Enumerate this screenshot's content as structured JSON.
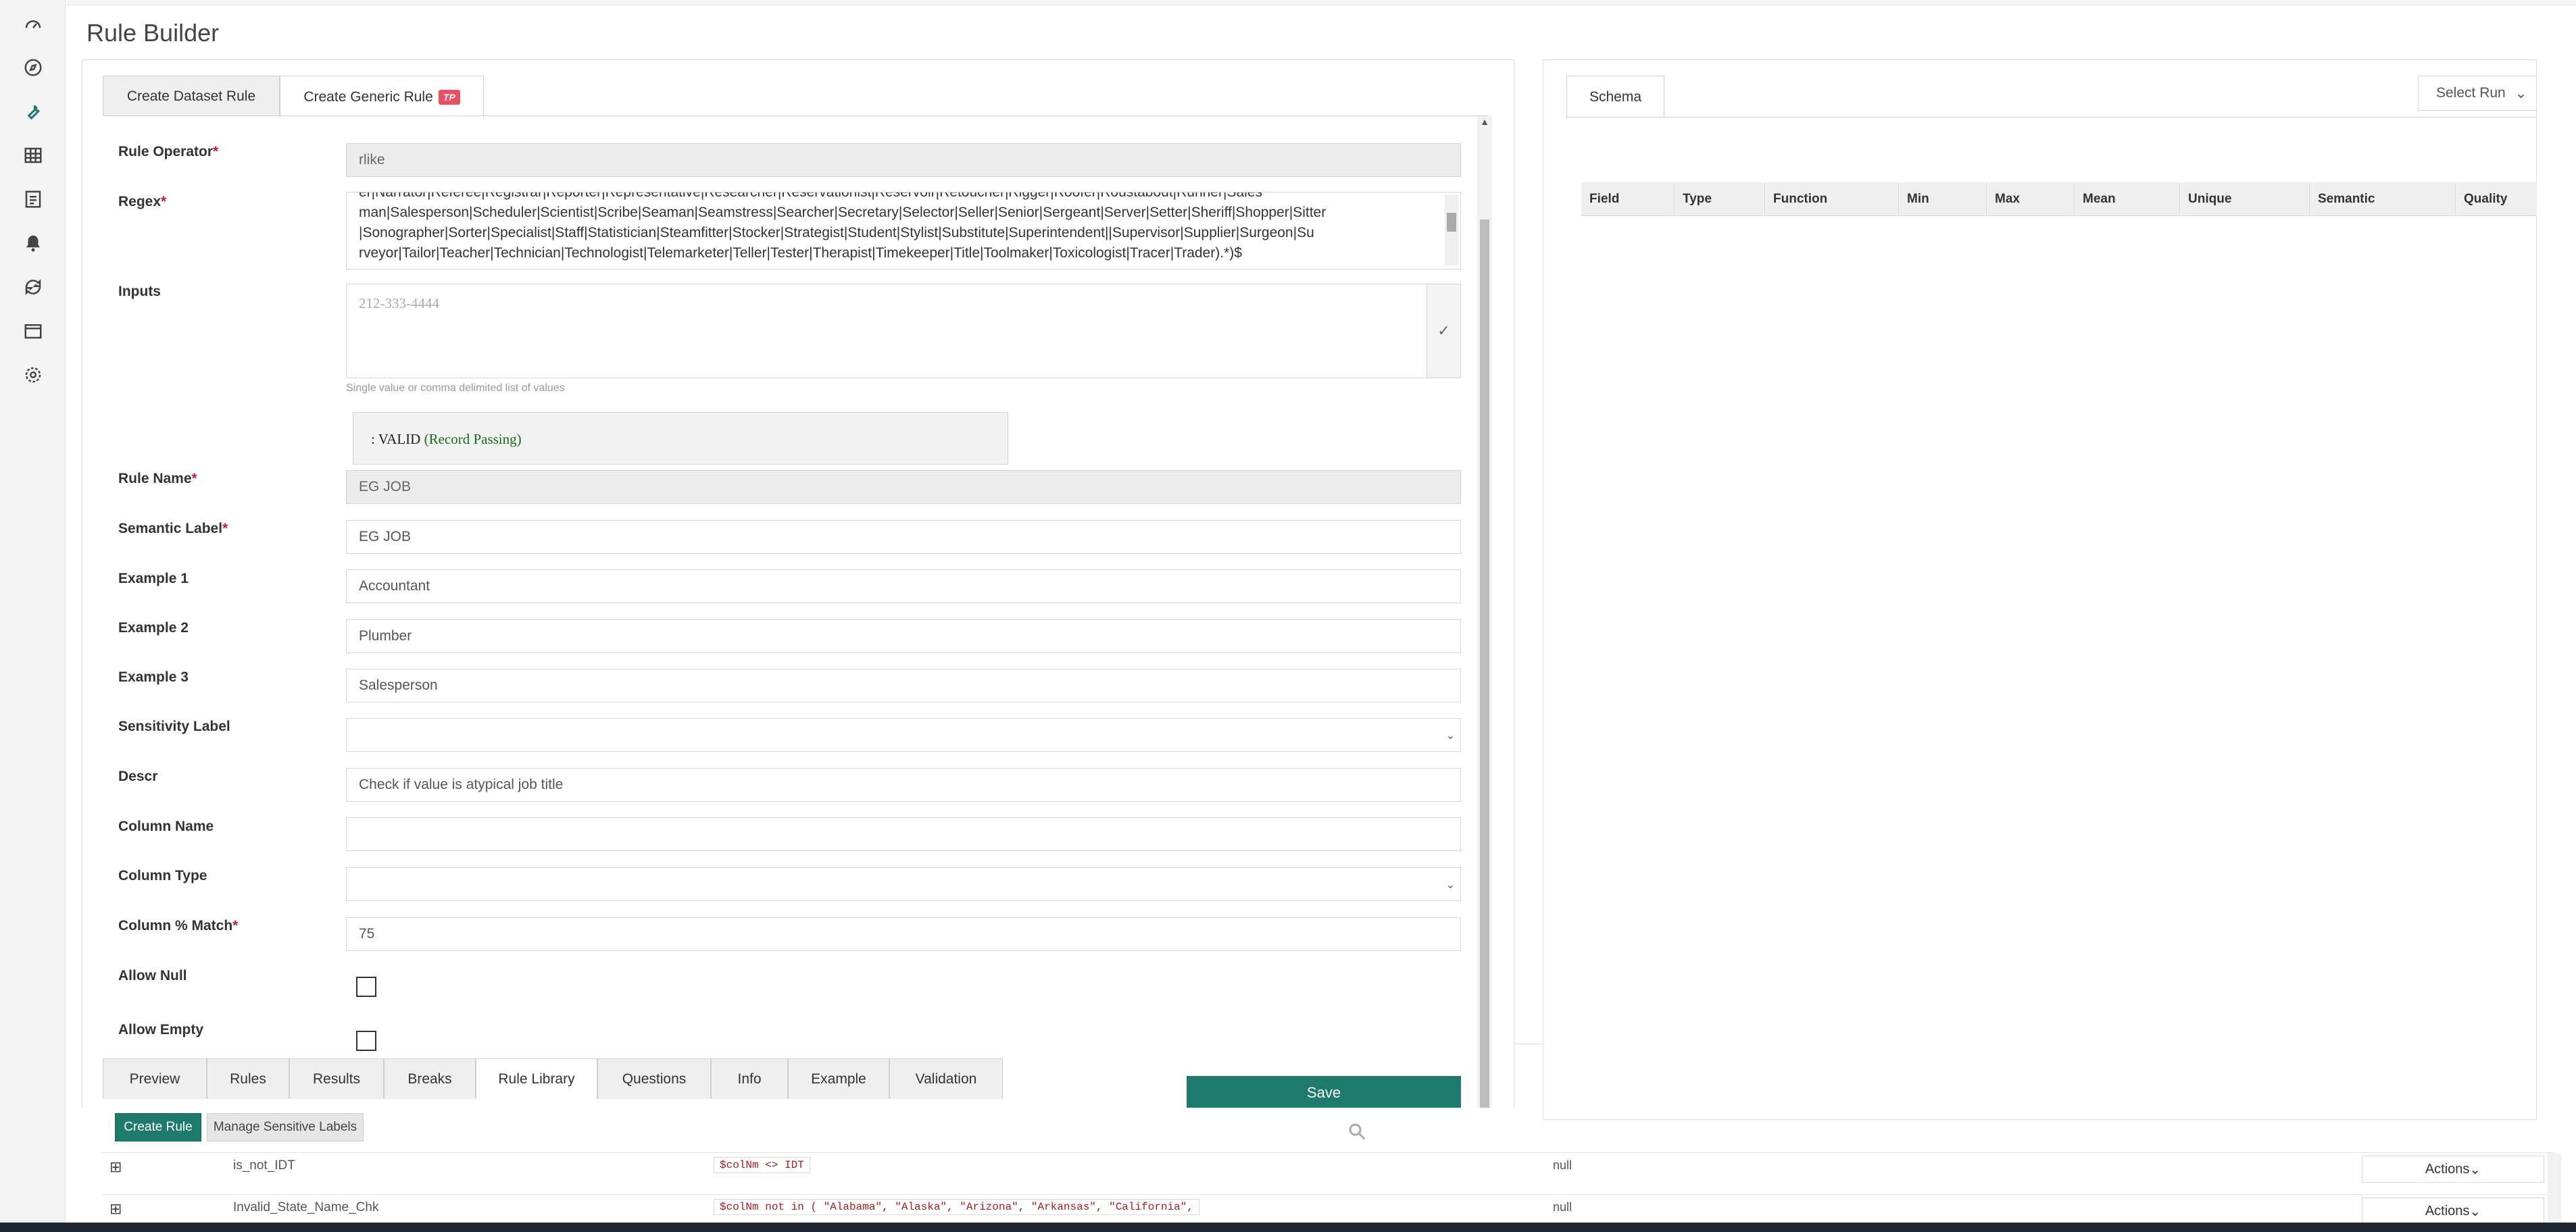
{
  "page": {
    "title": "Rule Builder"
  },
  "sidebar": {
    "icons": [
      "dashboard-icon",
      "compass-icon",
      "wrench-icon",
      "table-icon",
      "report-icon",
      "bell-icon",
      "sync-icon",
      "calendar-icon",
      "gear-icon"
    ],
    "active": "wrench-icon"
  },
  "tabs_top": [
    {
      "label": "Create Dataset Rule"
    },
    {
      "label": "Create Generic Rule",
      "badge": "TP"
    }
  ],
  "form": {
    "rule_operator": {
      "label": "Rule Operator",
      "required": "*",
      "value": "rlike"
    },
    "regex": {
      "label": "Regex",
      "required": "*",
      "lines": [
        "er|Narrator|Referee|Registrar|Reporter|Representative|Researcher|Reservationist|Reservoir|Retoucher|Rigger|Roofer|Roustabout|Runner|Sales",
        "man|Salesperson|Scheduler|Scientist|Scribe|Seaman|Seamstress|Searcher|Secretary|Selector|Seller|Senior|Sergeant|Server|Setter|Sheriff|Shopper|Sitter",
        "|Sonographer|Sorter|Specialist|Staff|Statistician|Steamfitter|Stocker|Strategist|Student|Stylist|Substitute|Superintendent||Supervisor|Supplier|Surgeon|Su",
        "rveyor|Tailor|Teacher|Technician|Technologist|Telemarketer|Teller|Tester|Therapist|Timekeeper|Title|Toolmaker|Toxicologist|Tracer|Trader).*)$"
      ]
    },
    "inputs": {
      "label": "Inputs",
      "placeholder": "212-333-4444",
      "help": "Single value or comma delimited list of values"
    },
    "validation_result": {
      "prefix": ": VALID",
      "status": "(Record Passing)"
    },
    "rule_name": {
      "label": "Rule Name",
      "required": "*",
      "value": "EG JOB"
    },
    "semantic_label": {
      "label": "Semantic Label",
      "required": "*",
      "value": "EG JOB"
    },
    "example1": {
      "label": "Example 1",
      "value": "Accountant"
    },
    "example2": {
      "label": "Example 2",
      "value": "Plumber"
    },
    "example3": {
      "label": "Example 3",
      "value": "Salesperson"
    },
    "sensitivity_label": {
      "label": "Sensitivity Label",
      "value": ""
    },
    "descr": {
      "label": "Descr",
      "value": "Check if value is atypical job title"
    },
    "column_name": {
      "label": "Column Name",
      "value": ""
    },
    "column_type": {
      "label": "Column Type",
      "value": ""
    },
    "column_match": {
      "label": "Column % Match",
      "required": "*",
      "value": "75"
    },
    "allow_null": {
      "label": "Allow Null"
    },
    "allow_empty": {
      "label": "Allow Empty"
    }
  },
  "tabs_bottom": [
    {
      "label": "Preview"
    },
    {
      "label": "Rules"
    },
    {
      "label": "Results"
    },
    {
      "label": "Breaks"
    },
    {
      "label": "Rule Library"
    },
    {
      "label": "Questions"
    },
    {
      "label": "Info"
    },
    {
      "label": "Example"
    },
    {
      "label": "Validation"
    }
  ],
  "actions": {
    "save": "Save",
    "create_rule": "Create Rule",
    "manage_labels": "Manage Sensitive Labels"
  },
  "rule_library": [
    {
      "expand": "⊞",
      "name": "is_not_IDT",
      "expr": "$colNm <> IDT",
      "value": "null",
      "action": "Actions"
    },
    {
      "expand": "⊞",
      "name": "Invalid_State_Name_Chk",
      "expr": "$colNm not in ( \"Alabama\", \"Alaska\", \"Arizona\", \"Arkansas\", \"California\",",
      "value": "null",
      "action": "Actions"
    }
  ],
  "schema": {
    "tab": "Schema",
    "select_run": "Select Run",
    "columns": [
      "Field",
      "Type",
      "Function",
      "Min",
      "Max",
      "Mean",
      "Unique",
      "Semantic",
      "Quality"
    ]
  }
}
